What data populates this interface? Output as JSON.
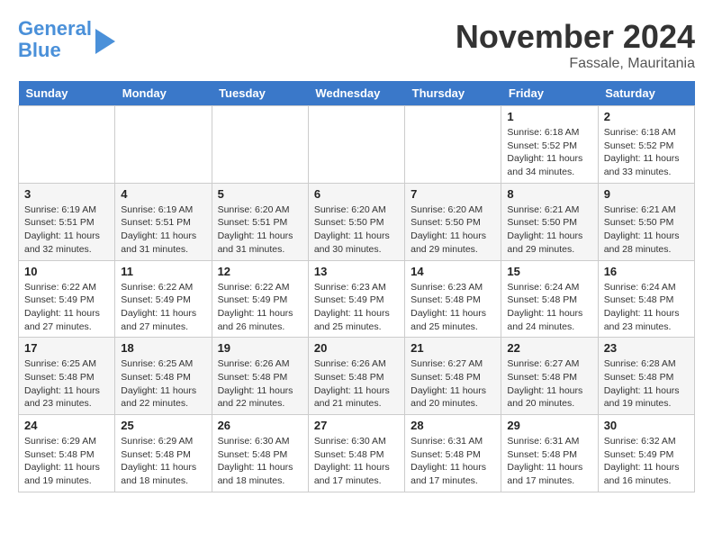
{
  "logo": {
    "line1": "General",
    "line2": "Blue"
  },
  "title": "November 2024",
  "location": "Fassale, Mauritania",
  "weekdays": [
    "Sunday",
    "Monday",
    "Tuesday",
    "Wednesday",
    "Thursday",
    "Friday",
    "Saturday"
  ],
  "weeks": [
    [
      {
        "day": "",
        "info": ""
      },
      {
        "day": "",
        "info": ""
      },
      {
        "day": "",
        "info": ""
      },
      {
        "day": "",
        "info": ""
      },
      {
        "day": "",
        "info": ""
      },
      {
        "day": "1",
        "info": "Sunrise: 6:18 AM\nSunset: 5:52 PM\nDaylight: 11 hours\nand 34 minutes."
      },
      {
        "day": "2",
        "info": "Sunrise: 6:18 AM\nSunset: 5:52 PM\nDaylight: 11 hours\nand 33 minutes."
      }
    ],
    [
      {
        "day": "3",
        "info": "Sunrise: 6:19 AM\nSunset: 5:51 PM\nDaylight: 11 hours\nand 32 minutes."
      },
      {
        "day": "4",
        "info": "Sunrise: 6:19 AM\nSunset: 5:51 PM\nDaylight: 11 hours\nand 31 minutes."
      },
      {
        "day": "5",
        "info": "Sunrise: 6:20 AM\nSunset: 5:51 PM\nDaylight: 11 hours\nand 31 minutes."
      },
      {
        "day": "6",
        "info": "Sunrise: 6:20 AM\nSunset: 5:50 PM\nDaylight: 11 hours\nand 30 minutes."
      },
      {
        "day": "7",
        "info": "Sunrise: 6:20 AM\nSunset: 5:50 PM\nDaylight: 11 hours\nand 29 minutes."
      },
      {
        "day": "8",
        "info": "Sunrise: 6:21 AM\nSunset: 5:50 PM\nDaylight: 11 hours\nand 29 minutes."
      },
      {
        "day": "9",
        "info": "Sunrise: 6:21 AM\nSunset: 5:50 PM\nDaylight: 11 hours\nand 28 minutes."
      }
    ],
    [
      {
        "day": "10",
        "info": "Sunrise: 6:22 AM\nSunset: 5:49 PM\nDaylight: 11 hours\nand 27 minutes."
      },
      {
        "day": "11",
        "info": "Sunrise: 6:22 AM\nSunset: 5:49 PM\nDaylight: 11 hours\nand 27 minutes."
      },
      {
        "day": "12",
        "info": "Sunrise: 6:22 AM\nSunset: 5:49 PM\nDaylight: 11 hours\nand 26 minutes."
      },
      {
        "day": "13",
        "info": "Sunrise: 6:23 AM\nSunset: 5:49 PM\nDaylight: 11 hours\nand 25 minutes."
      },
      {
        "day": "14",
        "info": "Sunrise: 6:23 AM\nSunset: 5:48 PM\nDaylight: 11 hours\nand 25 minutes."
      },
      {
        "day": "15",
        "info": "Sunrise: 6:24 AM\nSunset: 5:48 PM\nDaylight: 11 hours\nand 24 minutes."
      },
      {
        "day": "16",
        "info": "Sunrise: 6:24 AM\nSunset: 5:48 PM\nDaylight: 11 hours\nand 23 minutes."
      }
    ],
    [
      {
        "day": "17",
        "info": "Sunrise: 6:25 AM\nSunset: 5:48 PM\nDaylight: 11 hours\nand 23 minutes."
      },
      {
        "day": "18",
        "info": "Sunrise: 6:25 AM\nSunset: 5:48 PM\nDaylight: 11 hours\nand 22 minutes."
      },
      {
        "day": "19",
        "info": "Sunrise: 6:26 AM\nSunset: 5:48 PM\nDaylight: 11 hours\nand 22 minutes."
      },
      {
        "day": "20",
        "info": "Sunrise: 6:26 AM\nSunset: 5:48 PM\nDaylight: 11 hours\nand 21 minutes."
      },
      {
        "day": "21",
        "info": "Sunrise: 6:27 AM\nSunset: 5:48 PM\nDaylight: 11 hours\nand 20 minutes."
      },
      {
        "day": "22",
        "info": "Sunrise: 6:27 AM\nSunset: 5:48 PM\nDaylight: 11 hours\nand 20 minutes."
      },
      {
        "day": "23",
        "info": "Sunrise: 6:28 AM\nSunset: 5:48 PM\nDaylight: 11 hours\nand 19 minutes."
      }
    ],
    [
      {
        "day": "24",
        "info": "Sunrise: 6:29 AM\nSunset: 5:48 PM\nDaylight: 11 hours\nand 19 minutes."
      },
      {
        "day": "25",
        "info": "Sunrise: 6:29 AM\nSunset: 5:48 PM\nDaylight: 11 hours\nand 18 minutes."
      },
      {
        "day": "26",
        "info": "Sunrise: 6:30 AM\nSunset: 5:48 PM\nDaylight: 11 hours\nand 18 minutes."
      },
      {
        "day": "27",
        "info": "Sunrise: 6:30 AM\nSunset: 5:48 PM\nDaylight: 11 hours\nand 17 minutes."
      },
      {
        "day": "28",
        "info": "Sunrise: 6:31 AM\nSunset: 5:48 PM\nDaylight: 11 hours\nand 17 minutes."
      },
      {
        "day": "29",
        "info": "Sunrise: 6:31 AM\nSunset: 5:48 PM\nDaylight: 11 hours\nand 17 minutes."
      },
      {
        "day": "30",
        "info": "Sunrise: 6:32 AM\nSunset: 5:49 PM\nDaylight: 11 hours\nand 16 minutes."
      }
    ]
  ]
}
